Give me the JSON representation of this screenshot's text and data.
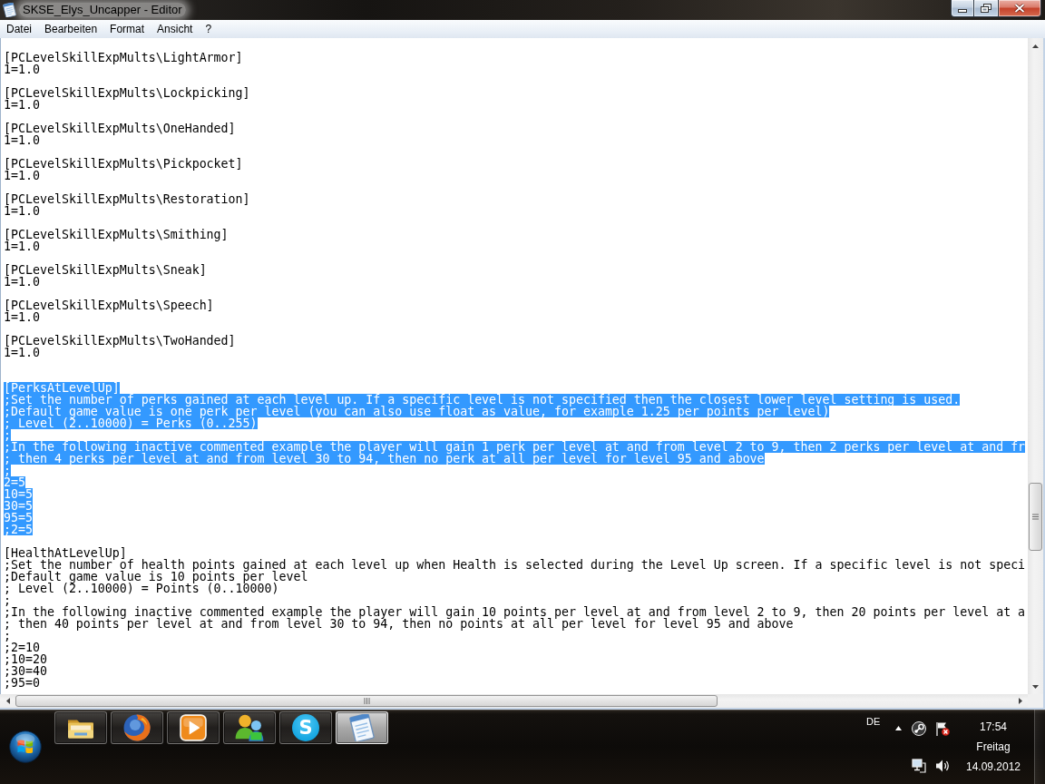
{
  "window": {
    "title": "SKSE_Elys_Uncapper - Editor"
  },
  "menu": [
    "Datei",
    "Bearbeiten",
    "Format",
    "Ansicht",
    "?"
  ],
  "editor": {
    "lines": [
      {
        "kind": "blank"
      },
      {
        "kind": "text",
        "text": "[PCLevelSkillExpMults\\LightArmor]",
        "selected": false
      },
      {
        "kind": "text",
        "text": "1=1.0",
        "selected": false
      },
      {
        "kind": "blank"
      },
      {
        "kind": "text",
        "text": "[PCLevelSkillExpMults\\Lockpicking]",
        "selected": false
      },
      {
        "kind": "text",
        "text": "1=1.0",
        "selected": false
      },
      {
        "kind": "blank"
      },
      {
        "kind": "text",
        "text": "[PCLevelSkillExpMults\\OneHanded]",
        "selected": false
      },
      {
        "kind": "text",
        "text": "1=1.0",
        "selected": false
      },
      {
        "kind": "blank"
      },
      {
        "kind": "text",
        "text": "[PCLevelSkillExpMults\\Pickpocket]",
        "selected": false
      },
      {
        "kind": "text",
        "text": "1=1.0",
        "selected": false
      },
      {
        "kind": "blank"
      },
      {
        "kind": "text",
        "text": "[PCLevelSkillExpMults\\Restoration]",
        "selected": false
      },
      {
        "kind": "text",
        "text": "1=1.0",
        "selected": false
      },
      {
        "kind": "blank"
      },
      {
        "kind": "text",
        "text": "[PCLevelSkillExpMults\\Smithing]",
        "selected": false
      },
      {
        "kind": "text",
        "text": "1=1.0",
        "selected": false
      },
      {
        "kind": "blank"
      },
      {
        "kind": "text",
        "text": "[PCLevelSkillExpMults\\Sneak]",
        "selected": false
      },
      {
        "kind": "text",
        "text": "1=1.0",
        "selected": false
      },
      {
        "kind": "blank"
      },
      {
        "kind": "text",
        "text": "[PCLevelSkillExpMults\\Speech]",
        "selected": false
      },
      {
        "kind": "text",
        "text": "1=1.0",
        "selected": false
      },
      {
        "kind": "blank"
      },
      {
        "kind": "text",
        "text": "[PCLevelSkillExpMults\\TwoHanded]",
        "selected": false
      },
      {
        "kind": "text",
        "text": "1=1.0",
        "selected": false
      },
      {
        "kind": "blank"
      },
      {
        "kind": "blank"
      },
      {
        "kind": "text",
        "text": "[PerksAtLevelUp]",
        "selected": true
      },
      {
        "kind": "text",
        "text": ";Set the number of perks gained at each level up. If a specific level is not specified then the closest lower level setting is used.",
        "selected": true
      },
      {
        "kind": "text",
        "text": ";Default game value is one perk per level (you can also use float as value, for example 1.25 per points per level)",
        "selected": true
      },
      {
        "kind": "text",
        "text": "; Level (2..10000) = Perks (0..255)",
        "selected": true
      },
      {
        "kind": "text",
        "text": ";",
        "selected": true
      },
      {
        "kind": "text",
        "text": ";In the following inactive commented example the player will gain 1 perk per level at and from level 2 to 9, then 2 perks per level at and fr",
        "selected": true
      },
      {
        "kind": "text",
        "text": "; then 4 perks per level at and from level 30 to 94, then no perk at all per level for level 95 and above",
        "selected": true
      },
      {
        "kind": "text",
        "text": ";",
        "selected": true
      },
      {
        "kind": "text",
        "text": "2=5",
        "selected": true
      },
      {
        "kind": "text",
        "text": "10=5",
        "selected": true
      },
      {
        "kind": "text",
        "text": "30=5",
        "selected": true
      },
      {
        "kind": "text",
        "text": "95=5",
        "selected": true
      },
      {
        "kind": "text",
        "text": ";2=5",
        "selected": true
      },
      {
        "kind": "blank"
      },
      {
        "kind": "text",
        "text": "[HealthAtLevelUp]",
        "selected": false
      },
      {
        "kind": "text",
        "text": ";Set the number of health points gained at each level up when Health is selected during the Level Up screen. If a specific level is not speci",
        "selected": false
      },
      {
        "kind": "text",
        "text": ";Default game value is 10 points per level",
        "selected": false
      },
      {
        "kind": "text",
        "text": "; Level (2..10000) = Points (0..10000)",
        "selected": false
      },
      {
        "kind": "text",
        "text": ";",
        "selected": false
      },
      {
        "kind": "text",
        "text": ";In the following inactive commented example the player will gain 10 points per level at and from level 2 to 9, then 20 points per level at a",
        "selected": false
      },
      {
        "kind": "text",
        "text": "; then 40 points per level at and from level 30 to 94, then no points at all per level for level 95 and above",
        "selected": false
      },
      {
        "kind": "text",
        "text": ";",
        "selected": false
      },
      {
        "kind": "text",
        "text": ";2=10",
        "selected": false
      },
      {
        "kind": "text",
        "text": ";10=20",
        "selected": false
      },
      {
        "kind": "text",
        "text": ";30=40",
        "selected": false
      },
      {
        "kind": "text",
        "text": ";95=0",
        "selected": false
      }
    ]
  },
  "taskbar": {
    "buttons": [
      {
        "kind": "folder",
        "selected": false
      },
      {
        "kind": "globe",
        "selected": false
      },
      {
        "kind": "player",
        "selected": false
      },
      {
        "kind": "messenger",
        "selected": false
      },
      {
        "kind": "chat",
        "glyph": "S",
        "selected": false
      },
      {
        "kind": "notepad",
        "selected": true
      }
    ],
    "tray": {
      "language": "DE",
      "time": "17:54",
      "weekday": "Freitag",
      "date": "14.09.2012"
    }
  }
}
